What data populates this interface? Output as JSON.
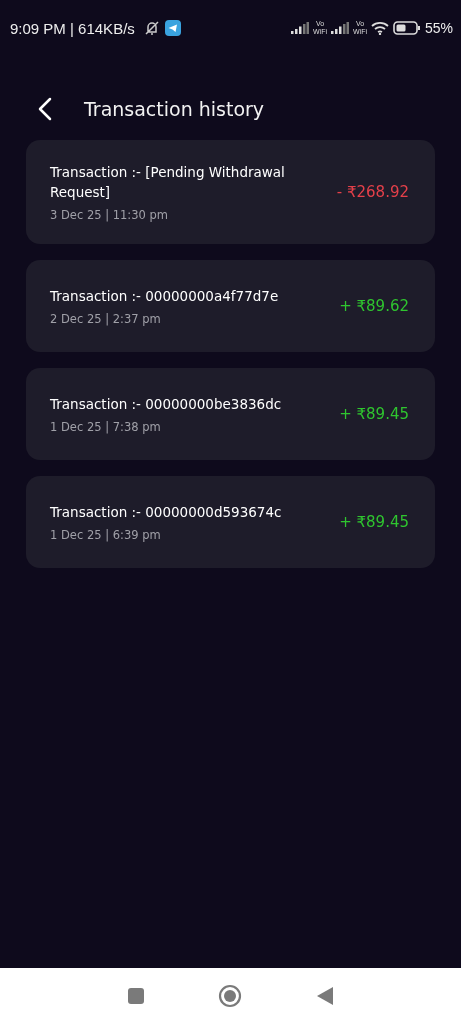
{
  "status_bar": {
    "time": "9:09 PM | 614KB/s",
    "sim_labels": [
      {
        "top": "Vo",
        "bottom": "WiFi"
      },
      {
        "top": "Vo",
        "bottom": "WiFi"
      }
    ],
    "battery": "55%"
  },
  "header": {
    "title": "Transaction history"
  },
  "transactions": [
    {
      "title": "Transaction :- [Pending Withdrawal Request]",
      "date": "3 Dec 25 | 11:30 pm",
      "amount": "- ₹268.92",
      "kind": "debit"
    },
    {
      "title": "Transaction :- 00000000a4f77d7e",
      "date": "2 Dec 25 | 2:37 pm",
      "amount": "+ ₹89.62",
      "kind": "credit"
    },
    {
      "title": "Transaction :- 00000000be3836dc",
      "date": "1 Dec 25 | 7:38 pm",
      "amount": "+ ₹89.45",
      "kind": "credit"
    },
    {
      "title": "Transaction :- 00000000d593674c",
      "date": "1 Dec 25 | 6:39 pm",
      "amount": "+ ₹89.45",
      "kind": "credit"
    }
  ]
}
